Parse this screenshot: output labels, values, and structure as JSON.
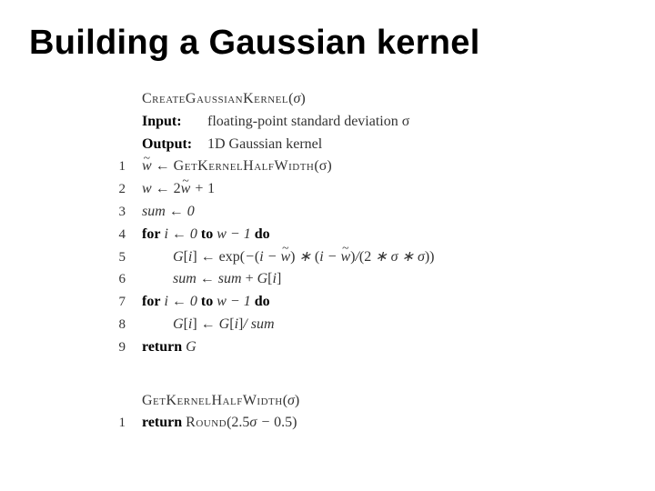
{
  "title": "Building a Gaussian kernel",
  "proc1": {
    "name": "CreateGaussianKernel",
    "arg": "σ",
    "input_label": "Input:",
    "input_text": "floating-point standard deviation σ",
    "output_label": "Output:",
    "output_text": "1D Gaussian kernel",
    "lines_num": [
      "1",
      "2",
      "3",
      "4",
      "5",
      "6",
      "7",
      "8",
      "9"
    ],
    "l1_a": "w̃ ← ",
    "l1_call": "GetKernelHalfWidth",
    "l1_b": "(σ)",
    "l2": "w ← 2w̃ + 1",
    "l3": "sum ← 0",
    "l4_for": "for",
    "l4_body": " i ← 0 ",
    "l4_to": "to",
    "l4_tail": " w − 1 ",
    "l4_do": "do",
    "l5": "G[i] ← exp(−(i − w̃) ∗ (i − w̃)/(2 ∗ σ ∗ σ))",
    "l6": "sum ← sum + G[i]",
    "l7_for": "for",
    "l7_body": " i ← 0 ",
    "l7_to": "to",
    "l7_tail": " w − 1 ",
    "l7_do": "do",
    "l8": "G[i] ← G[i]/ sum",
    "l9_ret": "return",
    "l9_val": " G"
  },
  "proc2": {
    "name": "GetKernelHalfWidth",
    "arg": "σ",
    "line_num": "1",
    "ret": "return",
    "call": "Round",
    "expr": "(2.5σ − 0.5)"
  }
}
